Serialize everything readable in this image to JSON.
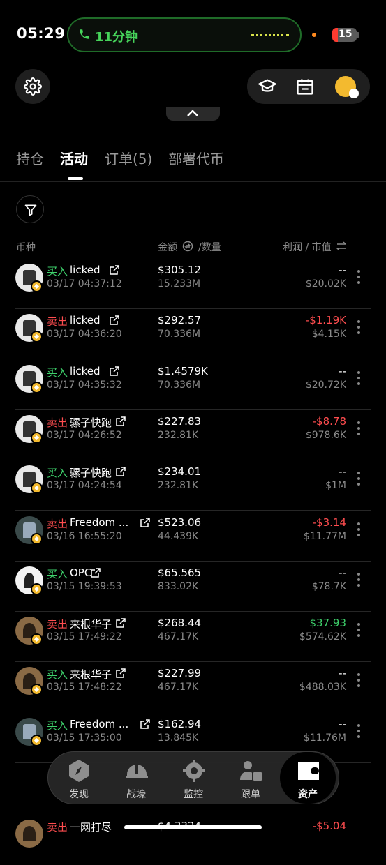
{
  "status_bar": {
    "time": "05:29",
    "call_timer": "11分钟",
    "battery": "15"
  },
  "header": {
    "settings_icon": "gear-icon",
    "actions": [
      "graduation-cap-icon",
      "calendar-icon",
      "bnb-avatar-icon"
    ]
  },
  "tabs": [
    {
      "label": "持仓",
      "active": false
    },
    {
      "label": "活动",
      "active": true
    },
    {
      "label": "订单(5)",
      "active": false
    },
    {
      "label": "部署代币",
      "active": false
    }
  ],
  "columns": {
    "coin": "币种",
    "amount": "金额",
    "qty": "/数量",
    "pnl_mcap": "利润 / 市值"
  },
  "rows": [
    {
      "side": "买入",
      "type": "buy",
      "name": "licked",
      "time": "03/17 04:37:12",
      "amount": "$305.12",
      "qty": "15.233M",
      "pnl": "--",
      "pnl_type": "none",
      "mcap": "$20.02K",
      "icon": "white"
    },
    {
      "side": "卖出",
      "type": "sell",
      "name": "licked",
      "time": "03/17 04:36:20",
      "amount": "$292.57",
      "qty": "70.336M",
      "pnl": "-$1.19K",
      "pnl_type": "neg",
      "mcap": "$4.15K",
      "icon": "white"
    },
    {
      "side": "买入",
      "type": "buy",
      "name": "licked",
      "time": "03/17 04:35:32",
      "amount": "$1.4579K",
      "qty": "70.336M",
      "pnl": "--",
      "pnl_type": "none",
      "mcap": "$20.72K",
      "icon": "white"
    },
    {
      "side": "卖出",
      "type": "sell",
      "name": "骡子快跑",
      "time": "03/17 04:26:52",
      "amount": "$227.83",
      "qty": "232.81K",
      "pnl": "-$8.78",
      "pnl_type": "neg",
      "mcap": "$978.6K",
      "icon": "white"
    },
    {
      "side": "买入",
      "type": "buy",
      "name": "骡子快跑",
      "time": "03/17 04:24:54",
      "amount": "$234.01",
      "qty": "232.81K",
      "pnl": "--",
      "pnl_type": "none",
      "mcap": "$1M",
      "icon": "white"
    },
    {
      "side": "卖出",
      "type": "sell",
      "name": "Freedom ...",
      "time": "03/16 16:55:20",
      "amount": "$523.06",
      "qty": "44.439K",
      "pnl": "-$3.14",
      "pnl_type": "neg",
      "mcap": "$11.77M",
      "icon": "dark"
    },
    {
      "side": "买入",
      "type": "buy",
      "name": "OPC",
      "time": "03/15 19:39:53",
      "amount": "$65.565",
      "qty": "833.02K",
      "pnl": "--",
      "pnl_type": "none",
      "mcap": "$78.7K",
      "icon": "logo"
    },
    {
      "side": "卖出",
      "type": "sell",
      "name": "来根华子",
      "time": "03/15 17:49:22",
      "amount": "$268.44",
      "qty": "467.17K",
      "pnl": "$37.93",
      "pnl_type": "pos",
      "mcap": "$574.62K",
      "icon": "photo"
    },
    {
      "side": "买入",
      "type": "buy",
      "name": "来根华子",
      "time": "03/15 17:48:22",
      "amount": "$227.99",
      "qty": "467.17K",
      "pnl": "--",
      "pnl_type": "none",
      "mcap": "$488.03K",
      "icon": "photo"
    },
    {
      "side": "买入",
      "type": "buy",
      "name": "Freedom ...",
      "time": "03/15 17:35:00",
      "amount": "$162.94",
      "qty": "13.845K",
      "pnl": "--",
      "pnl_type": "none",
      "mcap": "$11.76M",
      "icon": "dark"
    }
  ],
  "partial_rows": [
    {
      "side": "卖出",
      "name": "一网打尽",
      "amount": "$4.3324",
      "pnl": "-$5.04"
    }
  ],
  "bottom_nav": [
    {
      "label": "发现",
      "icon": "compass-icon",
      "active": false
    },
    {
      "label": "战壕",
      "icon": "helmet-icon",
      "active": false
    },
    {
      "label": "监控",
      "icon": "monitor-icon",
      "active": false
    },
    {
      "label": "跟单",
      "icon": "copy-trade-icon",
      "active": false
    },
    {
      "label": "资产",
      "icon": "wallet-icon",
      "active": true
    }
  ],
  "colors": {
    "buy": "#3ed06b",
    "sell": "#ff4d4f",
    "accent_green": "#46d35a",
    "bnb": "#f3ba2f"
  }
}
